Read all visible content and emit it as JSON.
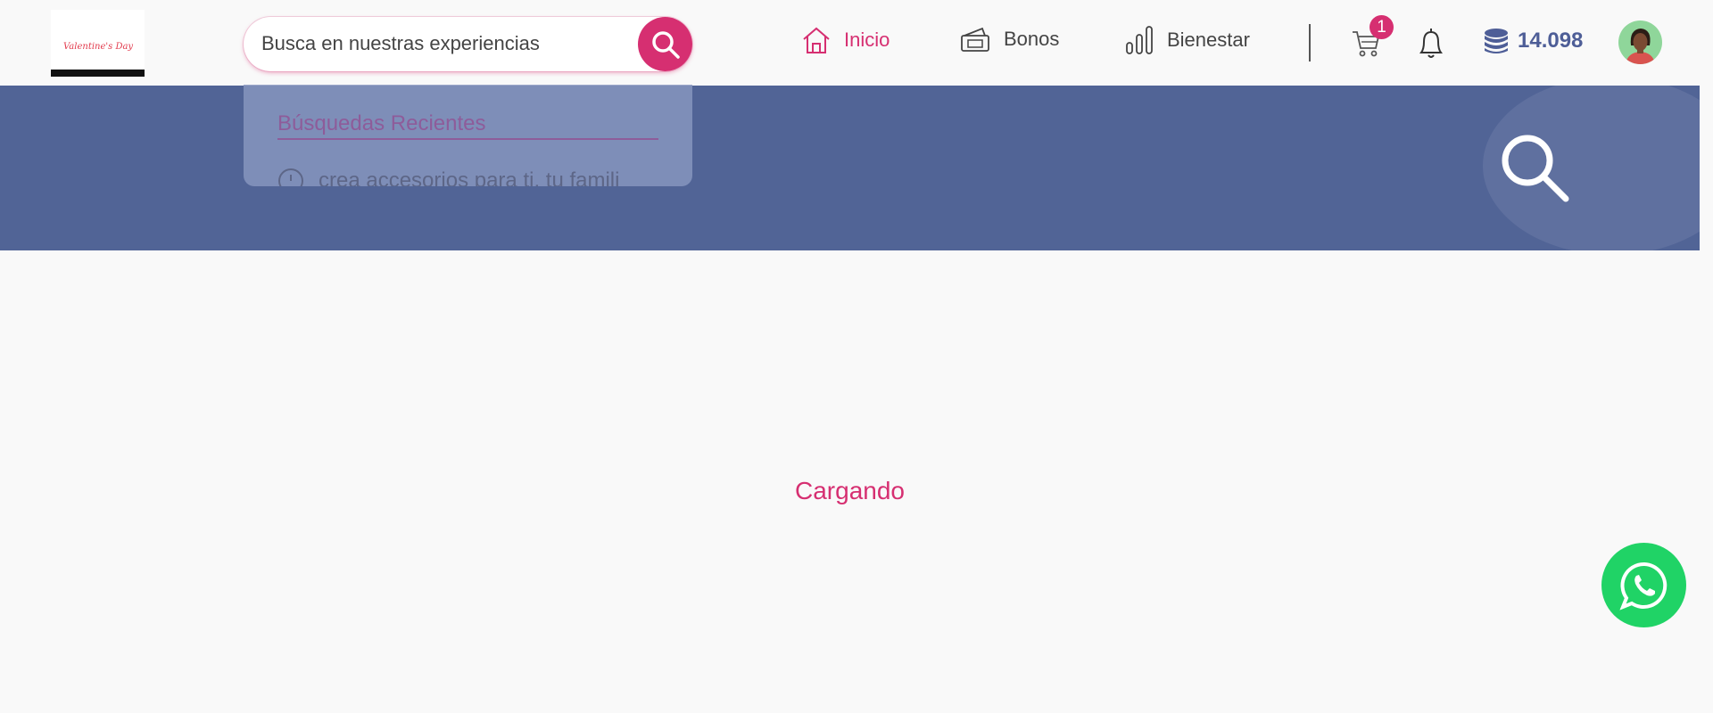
{
  "header": {
    "logo_text": "Valentine's Day",
    "search": {
      "placeholder": "Busca en nuestras experiencias",
      "value": ""
    },
    "nav": [
      {
        "label": "Inicio",
        "icon": "home-icon",
        "active": true
      },
      {
        "label": "Bonos",
        "icon": "ticket-icon",
        "active": false
      },
      {
        "label": "Bienestar",
        "icon": "bar-chart-icon",
        "active": false
      }
    ],
    "cart": {
      "icon": "cart-icon",
      "badge": "1"
    },
    "notifications_icon": "bell-icon",
    "points": {
      "icon": "coins-icon",
      "value": "14.098"
    },
    "avatar_icon": "user-avatar"
  },
  "search_dropdown": {
    "title": "Búsquedas Recientes",
    "items": [
      {
        "icon": "clock-icon",
        "text": "crea accesorios para ti, tu famili"
      }
    ]
  },
  "banner": {
    "icon": "search-icon"
  },
  "main": {
    "loading_text": "Cargando"
  },
  "whatsapp": {
    "icon": "whatsapp-icon"
  },
  "colors": {
    "accent": "#d62f71",
    "banner": "#516496",
    "points": "#4e5e97",
    "whatsapp": "#20d366"
  }
}
